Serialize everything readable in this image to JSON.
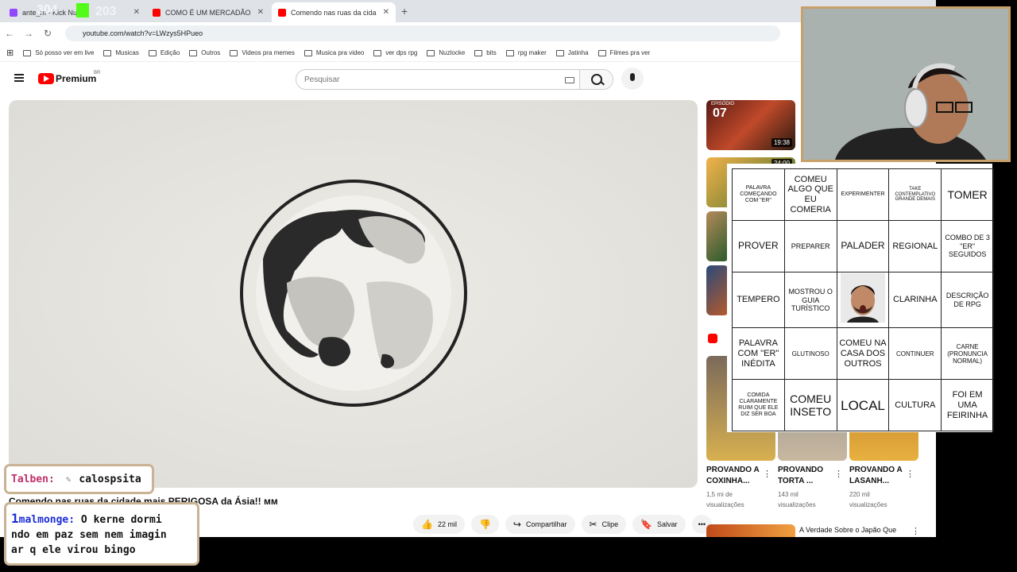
{
  "browser": {
    "tabs": [
      {
        "title": "ante_m - Kick Nub",
        "active": false,
        "favicon_color": "#9146ff"
      },
      {
        "title": "COMO É UM MERCADÃO DE C",
        "active": false,
        "favicon_color": "#ff0000"
      },
      {
        "title": "Comendo nas ruas da cidade m",
        "active": true,
        "favicon_color": "#ff0000"
      }
    ],
    "twitch_stats": {
      "viewers": "304",
      "other": "203"
    },
    "url": "youtube.com/watch?v=LWzys5HPueo",
    "bookmarks": [
      "Só posso ver em live",
      "Musicas",
      "Edição",
      "Outros",
      "Videos pra memes",
      "Musica pra video",
      "ver dps rpg",
      "Nuzlocke",
      "bits",
      "rpg maker",
      "Jatinha",
      "Filmes pra ver"
    ]
  },
  "youtube": {
    "brand": "Premium",
    "region": "BR",
    "search_placeholder": "Pesquisar",
    "video_title": "Comendo nas ruas da cidade mais PERIGOSA da Ásia!! мм",
    "actions": {
      "likes": "22 mil",
      "share": "Compartilhar",
      "clip": "Clipe",
      "save": "Salvar"
    },
    "recommended_top": [
      {
        "episode": "EPISÓDIO",
        "episode_num": "07",
        "duration": "19:38"
      },
      {
        "duration": "24:00"
      }
    ],
    "shorts": [
      {
        "title": "PROVANDO A COXINHA...",
        "views": "1,5 mi de visualizações"
      },
      {
        "title": "PROVANDO TORTA ...",
        "views": "143 mil visualizações"
      },
      {
        "title": "PROVANDO A LASANH...",
        "views": "220 mil visualizações"
      }
    ],
    "next_video_title": "A Verdade Sobre o Japão Que"
  },
  "bingo": [
    [
      "PALAVRA COMEÇANDO COM \"ER\"",
      "COMEU ALGO QUE EU COMERIA",
      "EXPERIMENTER",
      "TAKE CONTEMPLATIVO GRANDE DEMAIS",
      "TOMER"
    ],
    [
      "PROVER",
      "PREPARER",
      "PALADER",
      "REGIONAL",
      "COMBO DE 3 \"ER\" SEGUIDOS"
    ],
    [
      "TEMPERO",
      "MOSTROU O GUIA TURÍSTICO",
      "",
      "CLARINHA",
      "DESCRIÇÃO DE RPG"
    ],
    [
      "PALAVRA COM \"ER\" INÉDITA",
      "GLUTINOSO",
      "COMEU NA CASA DOS OUTROS",
      "CONTINUER",
      "CARNE (PRONUNCIA NORMAL)"
    ],
    [
      "COMIDA CLARAMENTE RUIM QUE ELE DIZ SER BOA",
      "COMEU INSETO",
      "LOCAL",
      "CULTURA",
      "FOI EM UMA FEIRINHA"
    ]
  ],
  "chat": [
    {
      "user": "Talben:",
      "user_color": "#c0306a",
      "message": "calospsita"
    },
    {
      "user": "malmonge:",
      "user_color": "#1a2bd6",
      "message_lines": [
        "O kerne dormi",
        "ndo em paz sem nem imagin",
        "ar q ele virou bingo"
      ]
    }
  ]
}
